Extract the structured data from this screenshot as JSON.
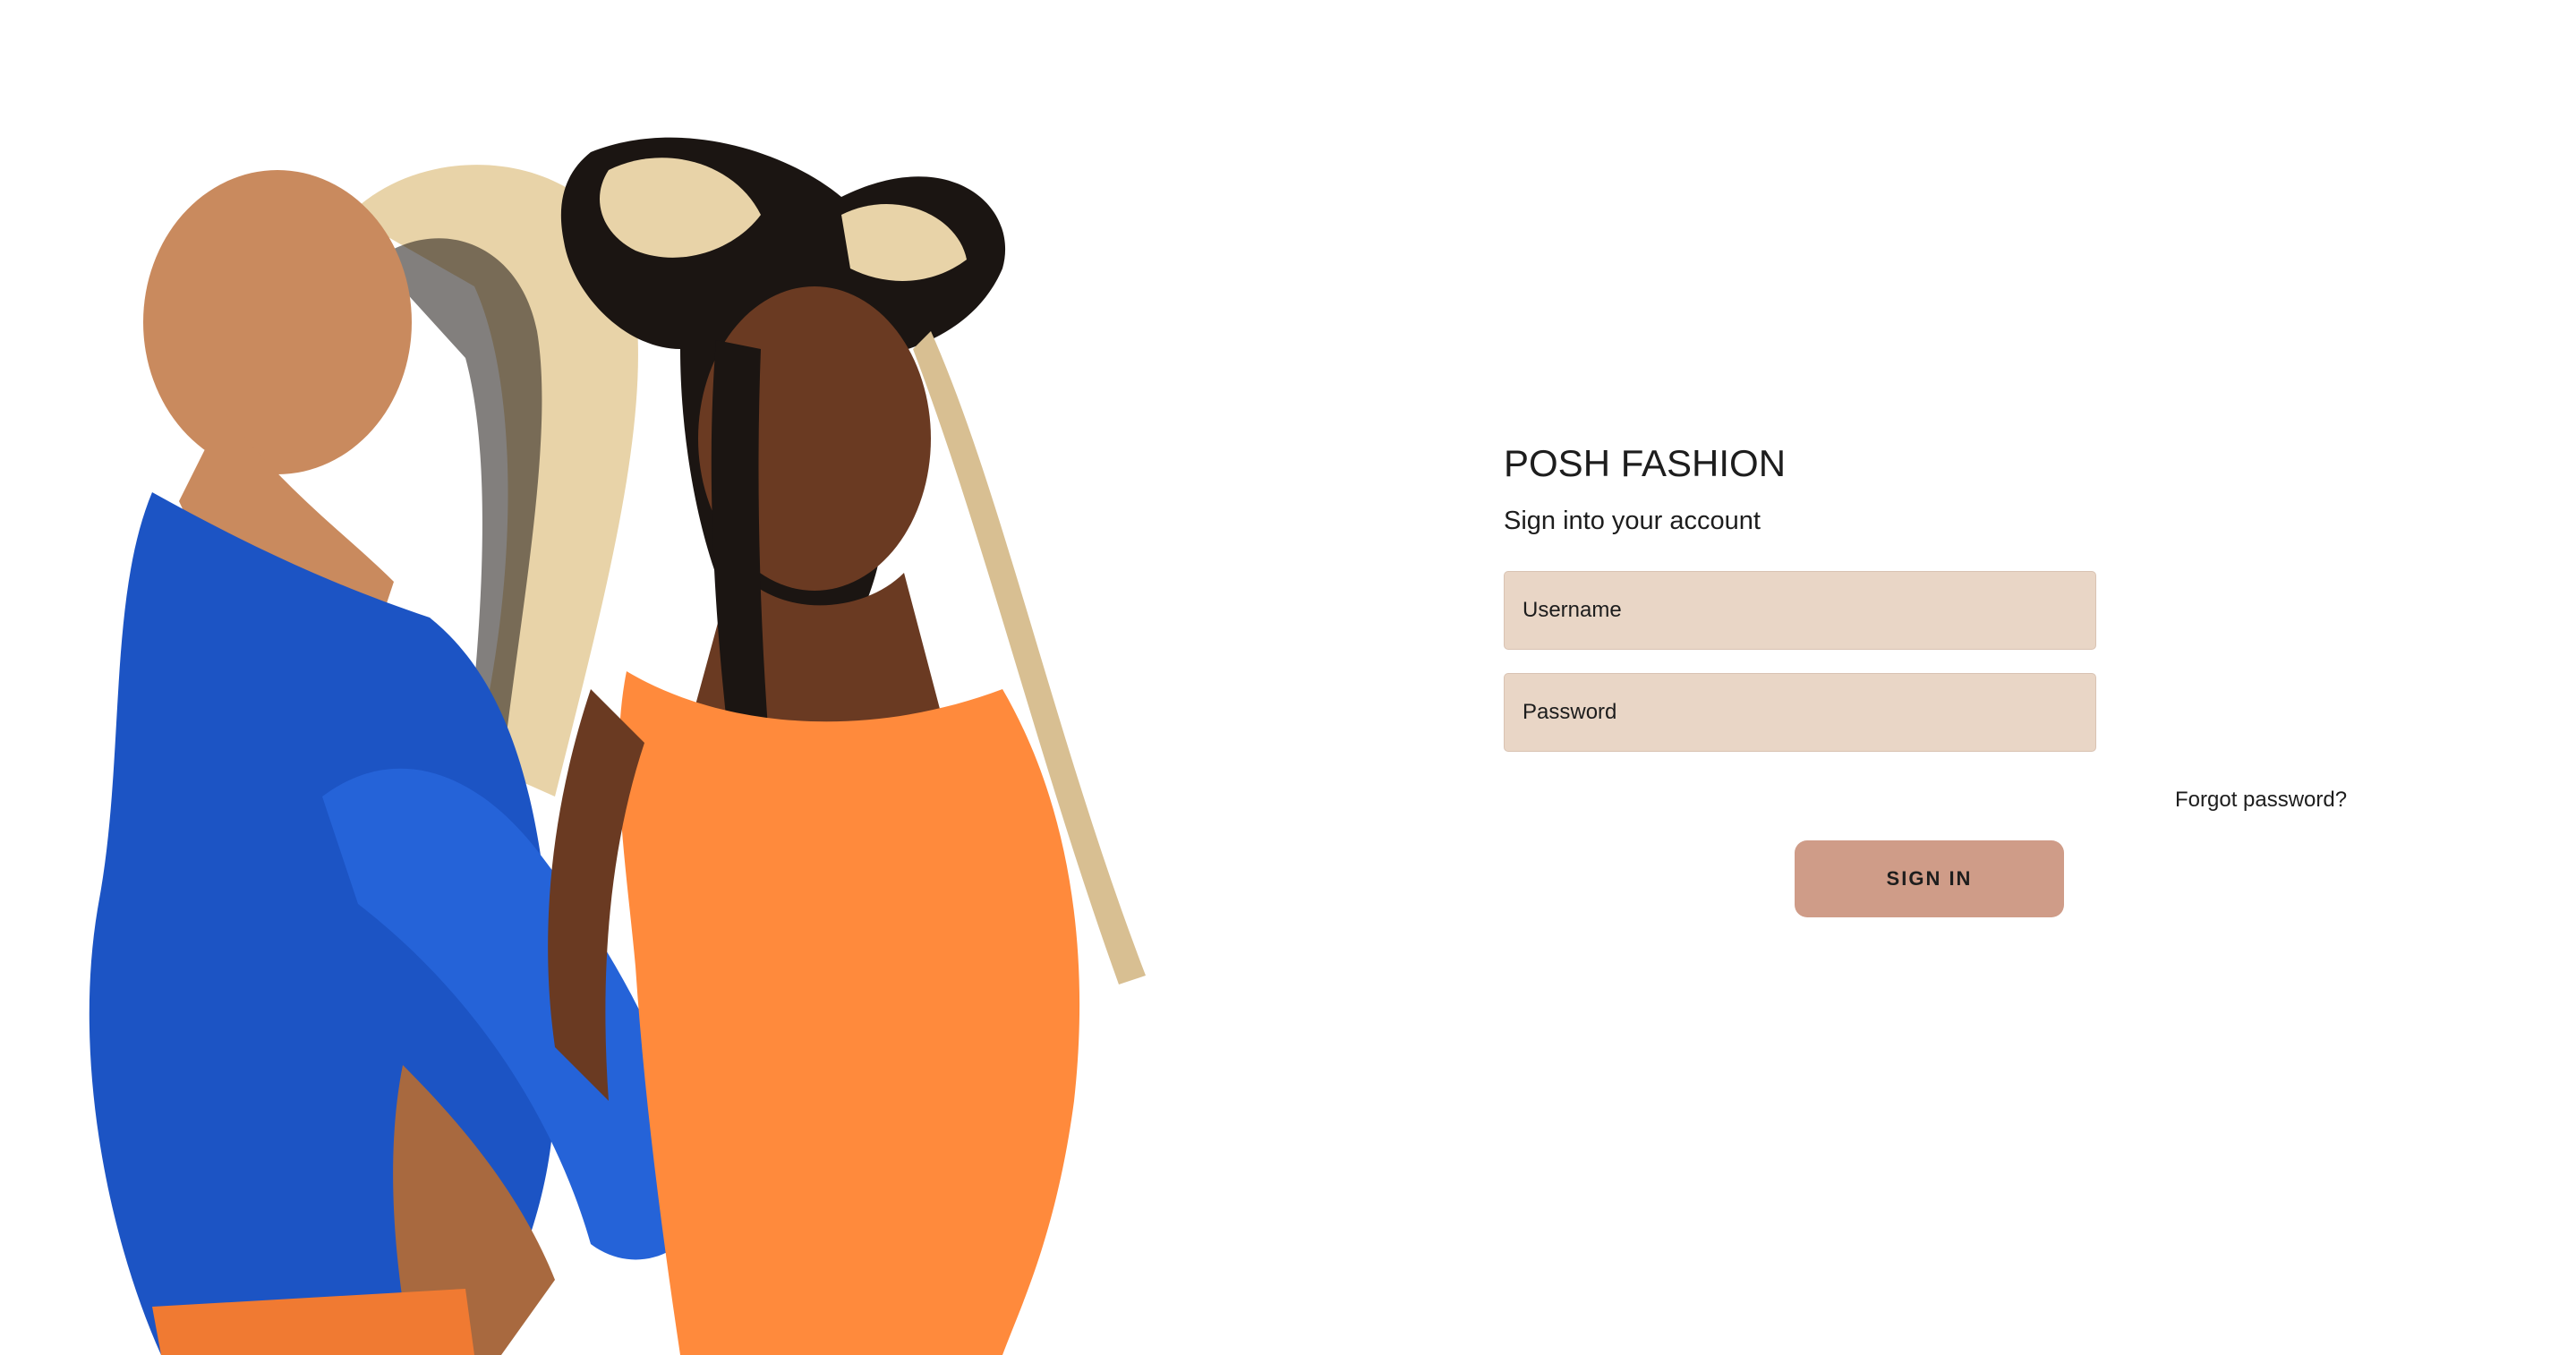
{
  "app": {
    "brand": "POSH FASHION"
  },
  "login": {
    "subtitle": "Sign into your account",
    "username_placeholder": "Username",
    "password_placeholder": "Password",
    "forgot_label": "Forgot password?",
    "signin_label": "SIGN IN"
  },
  "hero": {
    "image": "hero-image",
    "colors": {
      "blue_top": "#1c54c4",
      "orange_top": "#ff8a3c",
      "skin_light": "#c98a5e",
      "skin_dark": "#6a3a22",
      "braids_blonde": "#e8d3a8",
      "braids_black": "#1b1512"
    }
  },
  "theme": {
    "field_bg": "#e9d6c6",
    "button_bg": "#cf9c88",
    "text": "#1d1d1d"
  }
}
